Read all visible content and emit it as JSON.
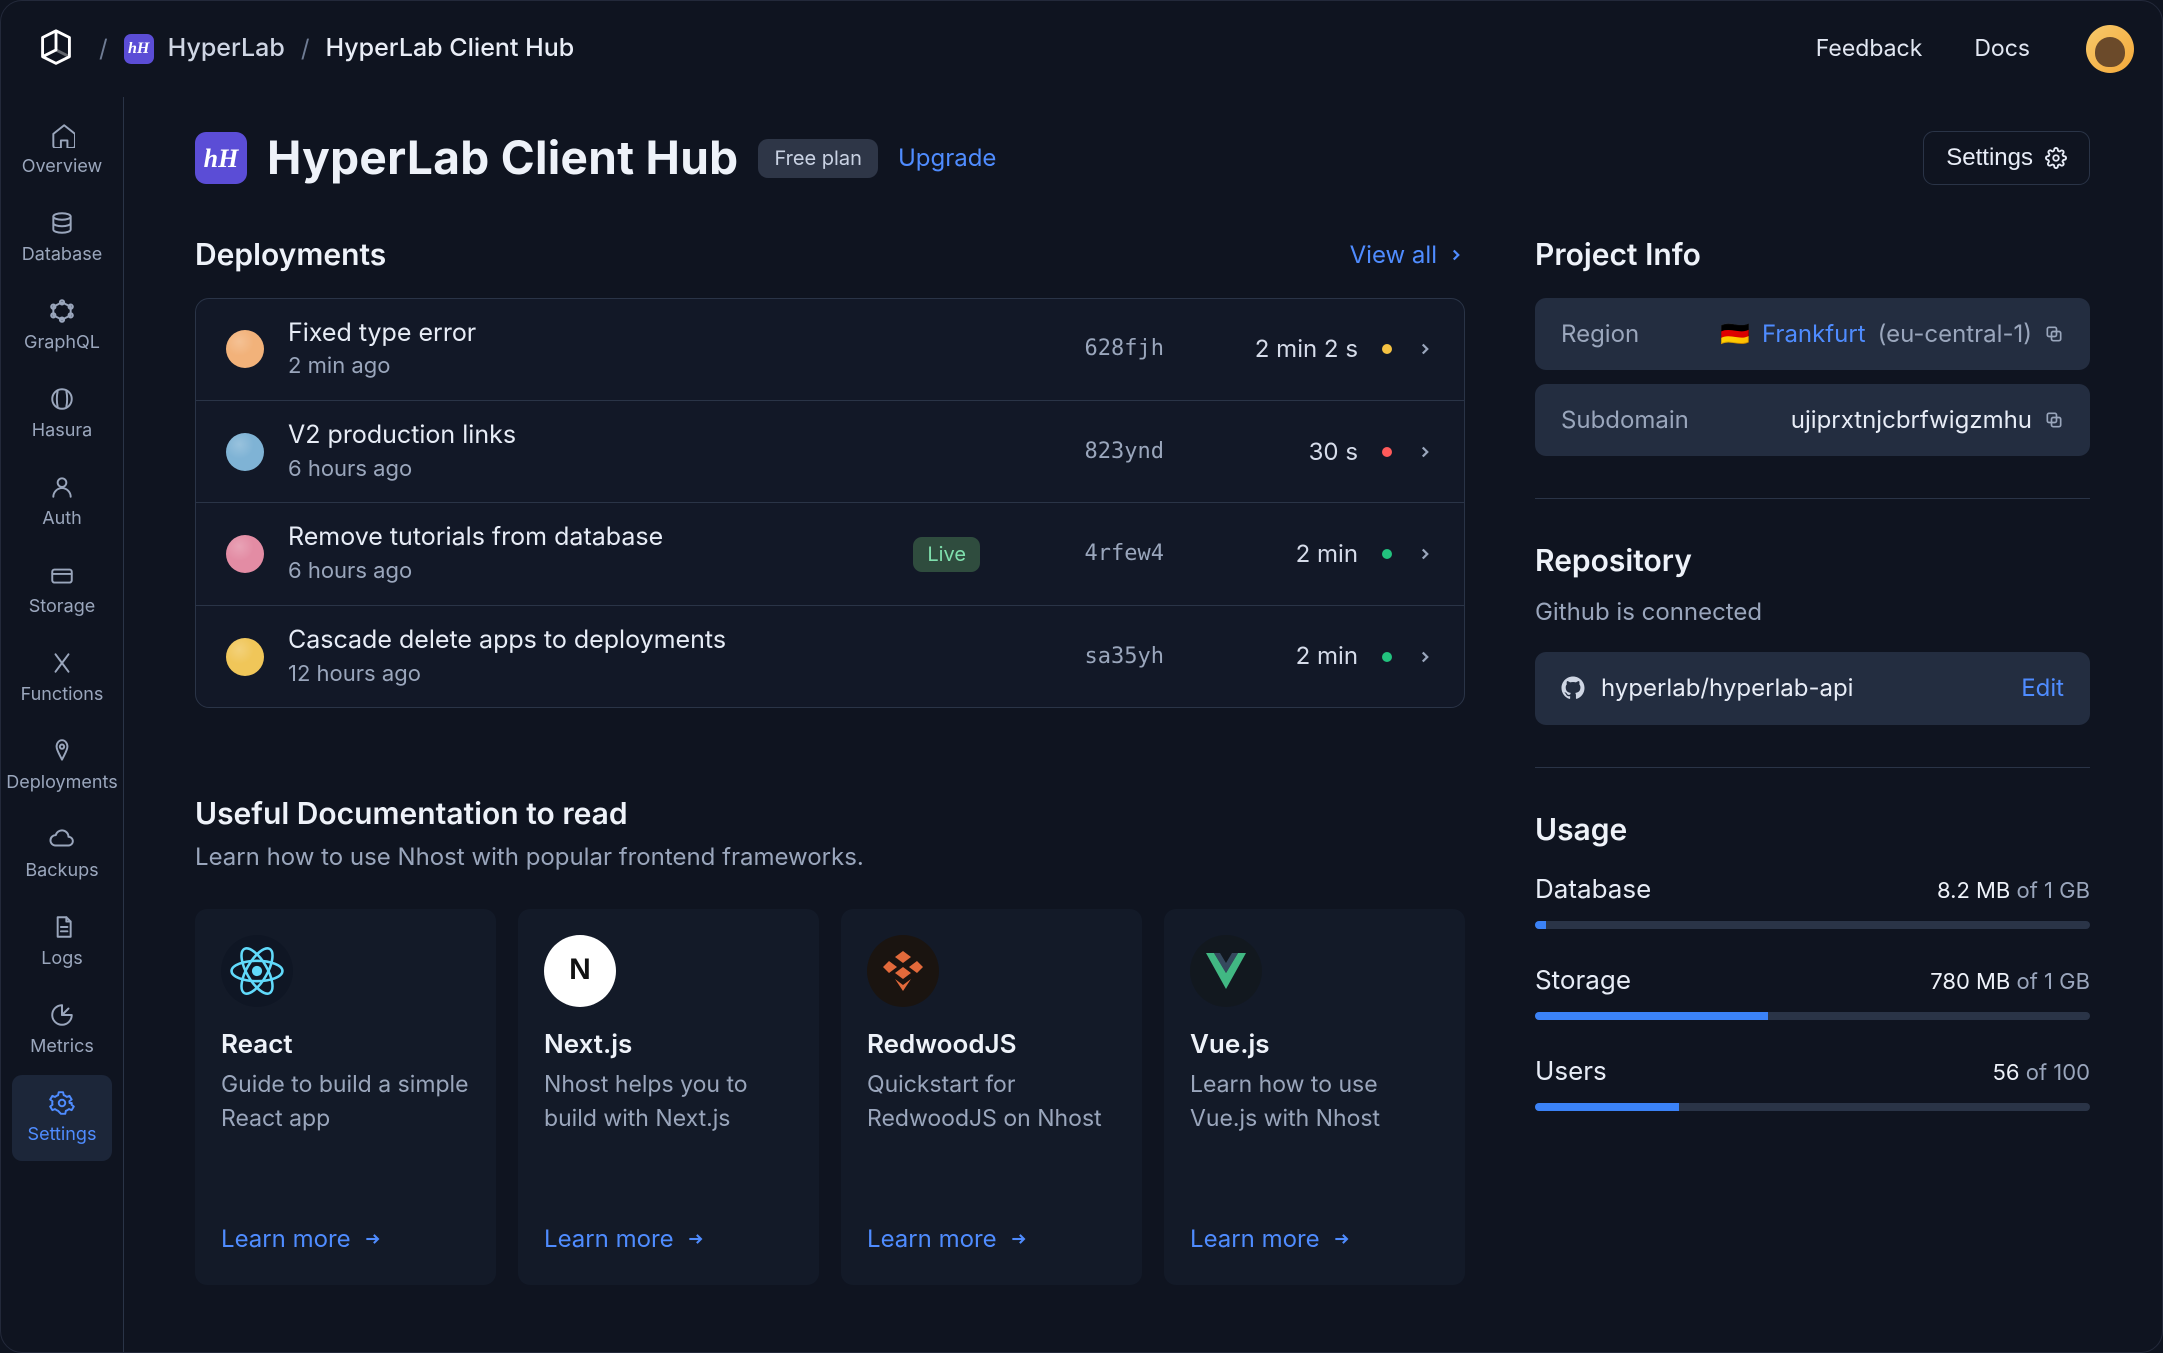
{
  "breadcrumb": {
    "workspace": "HyperLab",
    "project": "HyperLab Client Hub"
  },
  "top_links": {
    "feedback": "Feedback",
    "docs": "Docs"
  },
  "sidebar": [
    {
      "id": "overview",
      "label": "Overview"
    },
    {
      "id": "database",
      "label": "Database"
    },
    {
      "id": "graphql",
      "label": "GraphQL"
    },
    {
      "id": "hasura",
      "label": "Hasura"
    },
    {
      "id": "auth",
      "label": "Auth"
    },
    {
      "id": "storage",
      "label": "Storage"
    },
    {
      "id": "functions",
      "label": "Functions"
    },
    {
      "id": "deployments",
      "label": "Deployments"
    },
    {
      "id": "backups",
      "label": "Backups"
    },
    {
      "id": "logs",
      "label": "Logs"
    },
    {
      "id": "metrics",
      "label": "Metrics"
    },
    {
      "id": "settings",
      "label": "Settings"
    }
  ],
  "header": {
    "title": "HyperLab Client Hub",
    "plan_badge": "Free plan",
    "upgrade": "Upgrade",
    "settings": "Settings"
  },
  "deployments": {
    "title": "Deployments",
    "view_all": "View all",
    "rows": [
      {
        "title": "Fixed type error",
        "sub": "2 min ago",
        "hash": "628fjh",
        "duration": "2 min 2 s",
        "status": "yellow",
        "live": false,
        "avatar": "#f2b27a"
      },
      {
        "title": "V2 production links",
        "sub": "6 hours ago",
        "hash": "823ynd",
        "duration": "30 s",
        "status": "red",
        "live": false,
        "avatar": "#7fb3d5"
      },
      {
        "title": "Remove tutorials from database",
        "sub": "6 hours ago",
        "hash": "4rfew4",
        "duration": "2 min",
        "status": "green",
        "live": true,
        "avatar": "#e38ca4"
      },
      {
        "title": "Cascade delete apps to deployments",
        "sub": "12 hours ago",
        "hash": "sa35yh",
        "duration": "2 min",
        "status": "green",
        "live": false,
        "avatar": "#f0c659"
      }
    ],
    "live_label": "Live"
  },
  "docs": {
    "title": "Useful Documentation to read",
    "subtitle": "Learn how to use Nhost with popular frontend frameworks.",
    "learn_label": "Learn more",
    "cards": [
      {
        "name": "React",
        "desc": "Guide to build a simple React app",
        "icon": "react"
      },
      {
        "name": "Next.js",
        "desc": "Nhost helps you to build with Next.js",
        "icon": "next"
      },
      {
        "name": "RedwoodJS",
        "desc": "Quickstart for RedwoodJS on Nhost",
        "icon": "redwood"
      },
      {
        "name": "Vue.js",
        "desc": "Learn how to use Vue.js with Nhost",
        "icon": "vue"
      }
    ]
  },
  "project_info": {
    "title": "Project Info",
    "region_label": "Region",
    "region_city": "Frankfurt",
    "region_code": "(eu-central-1)",
    "subdomain_label": "Subdomain",
    "subdomain_value": "ujiprxtnjcbrfwigzmhu"
  },
  "repository": {
    "title": "Repository",
    "subtitle": "Github is connected",
    "repo": "hyperlab/hyperlab-api",
    "edit": "Edit"
  },
  "usage": {
    "title": "Usage",
    "items": [
      {
        "name": "Database",
        "value": "8.2 MB",
        "of": "of",
        "limit": "1 GB",
        "pct": 2
      },
      {
        "name": "Storage",
        "value": "780 MB",
        "of": "of",
        "limit": "1 GB",
        "pct": 42
      },
      {
        "name": "Users",
        "value": "56",
        "of": "of",
        "limit": "100",
        "pct": 26
      }
    ]
  }
}
